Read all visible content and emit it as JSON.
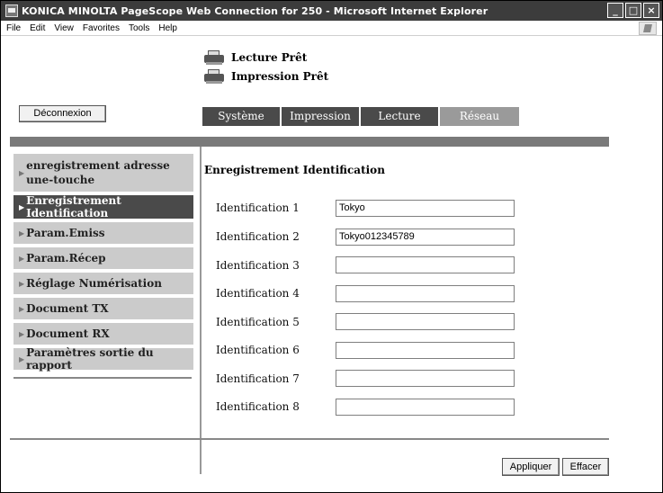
{
  "window": {
    "title": "KONICA MINOLTA PageScope Web Connection for 250 - Microsoft Internet Explorer",
    "controls": [
      "_",
      "□",
      "×"
    ]
  },
  "menubar": {
    "items": [
      "File",
      "Edit",
      "View",
      "Favorites",
      "Tools",
      "Help"
    ]
  },
  "status": {
    "scan": "Lecture Prêt",
    "print": "Impression Prêt"
  },
  "logout_label": "Déconnexion",
  "tabs": [
    {
      "label": "Système",
      "active": false
    },
    {
      "label": "Impression",
      "active": false
    },
    {
      "label": "Lecture",
      "active": false
    },
    {
      "label": "Réseau",
      "active": true
    }
  ],
  "sidebar": {
    "items": [
      {
        "label": "enregistrement adresse une-touche",
        "active": false
      },
      {
        "label": "Enregistrement Identification",
        "active": true
      },
      {
        "label": "Param.Emiss",
        "active": false
      },
      {
        "label": "Param.Récep",
        "active": false
      },
      {
        "label": "Réglage Numérisation",
        "active": false
      },
      {
        "label": "Document TX",
        "active": false
      },
      {
        "label": "Document RX",
        "active": false
      },
      {
        "label": "Paramètres sortie du rapport",
        "active": false
      }
    ]
  },
  "form": {
    "title": "Enregistrement Identification",
    "rows": [
      {
        "label": "Identification 1",
        "value": "Tokyo"
      },
      {
        "label": "Identification 2",
        "value": "Tokyo012345789"
      },
      {
        "label": "Identification 3",
        "value": ""
      },
      {
        "label": "Identification 4",
        "value": ""
      },
      {
        "label": "Identification 5",
        "value": ""
      },
      {
        "label": "Identification 6",
        "value": ""
      },
      {
        "label": "Identification 7",
        "value": ""
      },
      {
        "label": "Identification 8",
        "value": ""
      }
    ]
  },
  "buttons": {
    "apply": "Appliquer",
    "clear": "Effacer"
  },
  "colors": {
    "titlebar": "#3c3c3c",
    "tab": "#4a4a4a",
    "tab_active": "#9a9a9a",
    "sidebar_item": "#cbcbcb",
    "sidebar_active": "#4a4a4a",
    "band": "#7a7a7a"
  }
}
